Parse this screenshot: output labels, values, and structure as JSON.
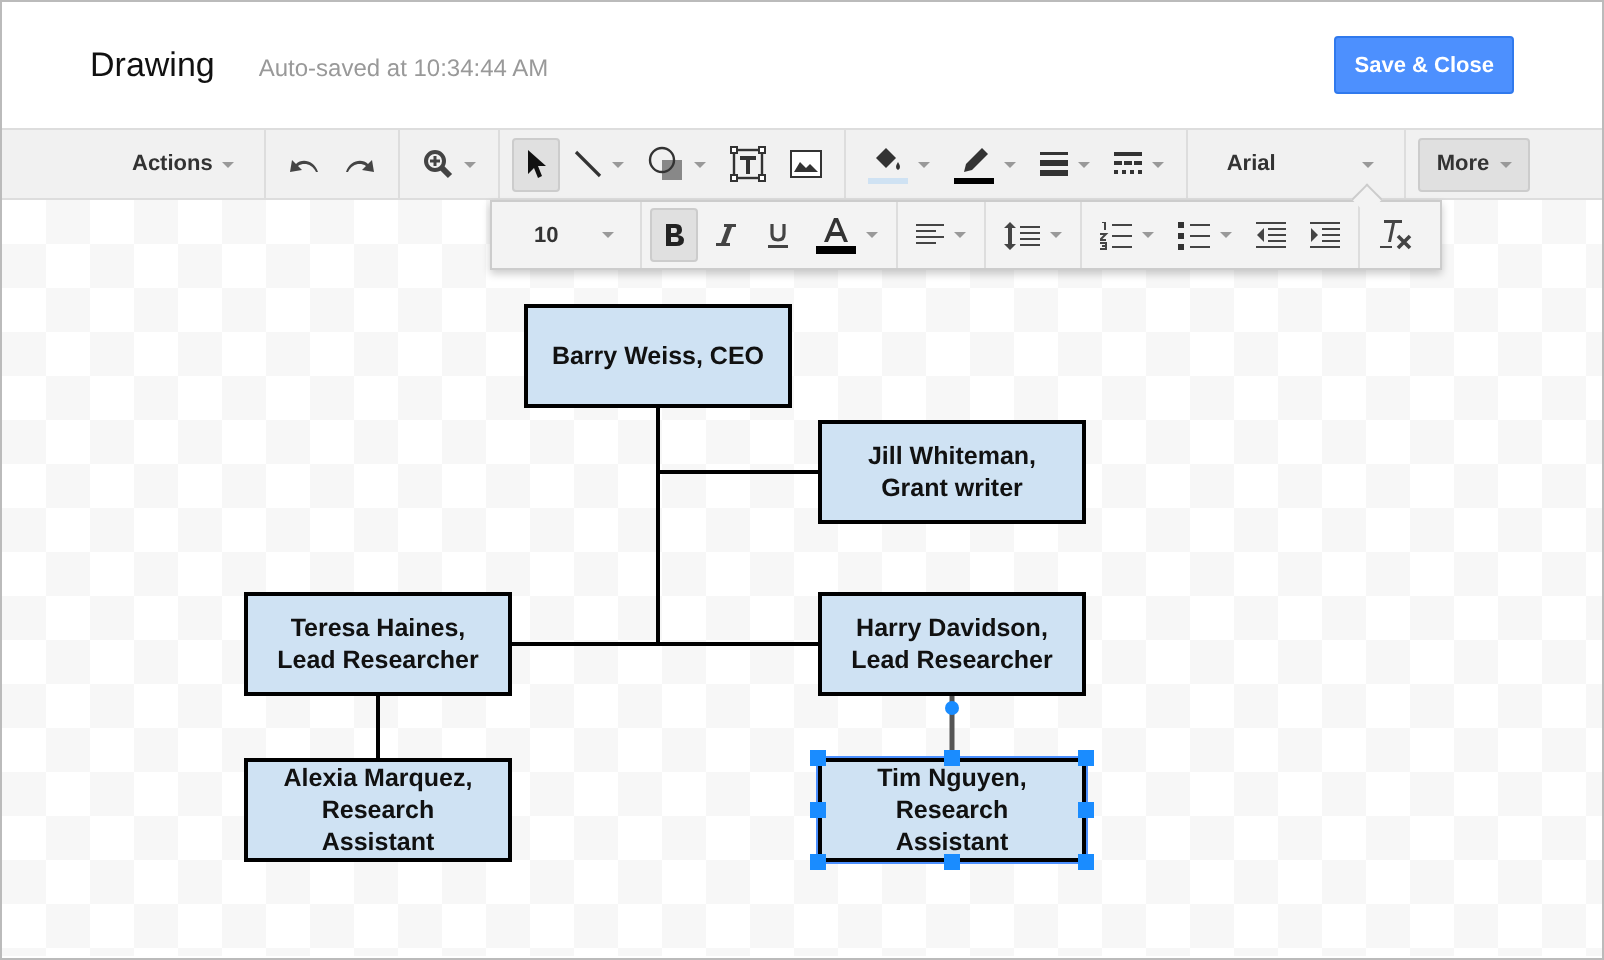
{
  "header": {
    "title": "Drawing",
    "status": "Auto-saved at 10:34:44 AM",
    "button": "Save & Close"
  },
  "toolbar": [
    {
      "items": [
        {
          "kind": "menu",
          "label": "Actions"
        }
      ]
    },
    {
      "items": [
        {
          "kind": "undo"
        },
        {
          "kind": "redo"
        }
      ]
    },
    {
      "items": [
        {
          "kind": "zoom"
        }
      ]
    },
    {
      "items": [
        {
          "kind": "select",
          "selected": true
        },
        {
          "kind": "line",
          "selected": false
        },
        {
          "kind": "shape",
          "selected": false
        },
        {
          "kind": "textbox",
          "selected": false
        },
        {
          "kind": "image",
          "selected": false
        }
      ]
    },
    {
      "items": [
        {
          "kind": "fill",
          "color": "#cfe2f3"
        },
        {
          "kind": "pen",
          "color": "#000000"
        },
        {
          "kind": "weight"
        },
        {
          "kind": "dash"
        }
      ]
    },
    {
      "items": [
        {
          "kind": "font",
          "label": "Arial"
        }
      ]
    },
    {
      "items": [
        {
          "kind": "more",
          "label": "More",
          "selected": true
        }
      ]
    }
  ],
  "format_bar": [
    {
      "items": [
        {
          "kind": "size",
          "label": "10"
        }
      ]
    },
    {
      "items": [
        {
          "kind": "bold",
          "selected": true
        },
        {
          "kind": "italic",
          "selected": false
        },
        {
          "kind": "underline",
          "selected": false
        },
        {
          "kind": "textcolor",
          "color": "#000000"
        }
      ]
    },
    {
      "items": [
        {
          "kind": "align"
        }
      ]
    },
    {
      "items": [
        {
          "kind": "spacing"
        }
      ]
    },
    {
      "items": [
        {
          "kind": "numbered"
        },
        {
          "kind": "bullets"
        },
        {
          "kind": "outdent"
        },
        {
          "kind": "indent"
        }
      ]
    },
    {
      "items": [
        {
          "kind": "clear"
        }
      ]
    }
  ],
  "nodes": [
    {
      "text": "Barry Weiss, CEO",
      "selected": false
    },
    {
      "text": "Jill Whiteman,\nGrant writer",
      "selected": false
    },
    {
      "text": "Teresa Haines,\nLead Researcher",
      "selected": false
    },
    {
      "text": "Harry Davidson,\nLead Researcher",
      "selected": false
    },
    {
      "text": "Alexia Marquez,\nResearch\nAssistant",
      "selected": false
    },
    {
      "text": "Tim Nguyen,\nResearch\nAssistant",
      "selected": true
    }
  ],
  "connectors": [
    {
      "selected": false
    },
    {
      "selected": false
    },
    {
      "selected": false
    },
    {
      "selected": false
    },
    {
      "selected": true
    }
  ]
}
